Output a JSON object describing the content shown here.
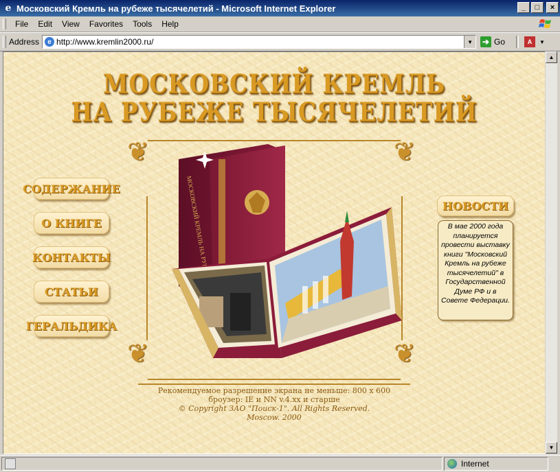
{
  "window": {
    "title": "Московский Кремль на рубеже тысячелетий - Microsoft Internet Explorer",
    "buttons": {
      "minimize": "_",
      "maximize": "□",
      "close": "×"
    }
  },
  "menu": [
    "File",
    "Edit",
    "View",
    "Favorites",
    "Tools",
    "Help"
  ],
  "address": {
    "label": "Address",
    "url": "http://www.kremlin2000.ru/",
    "go_label": "Go"
  },
  "page": {
    "title_line1": "МОСКОВСКИЙ КРЕМЛЬ",
    "title_line2": "НА РУБЕЖЕ ТЫСЯЧЕЛЕТИЙ",
    "nav": [
      "СОДЕРЖАНИЕ",
      "О КНИГЕ",
      "КОНТАКТЫ",
      "СТАТЬИ",
      "ГЕРАЛЬДИКА"
    ],
    "news": {
      "button": "НОВОСТИ",
      "text": "В мае 2000 года планируется провести выставку книги \"Московский Кремль на рубеже тысячелетий\" в Государственной Думе РФ и в Совете Федерации."
    },
    "footer": [
      "Рекомендуемое разрешение экрана не меньше: 800 x 600",
      "броузер: IE и NN v.4.xx и старше",
      "© Copyright ЗАО \"Поиск-1\". All Rights Reserved.",
      "Moscow. 2000"
    ]
  },
  "status": {
    "zone": "Internet"
  },
  "colors": {
    "title_gold": "#d99a24",
    "page_bg": "#f6e7bd",
    "titlebar": "#0a246a",
    "book_red": "#8b1c3a"
  }
}
